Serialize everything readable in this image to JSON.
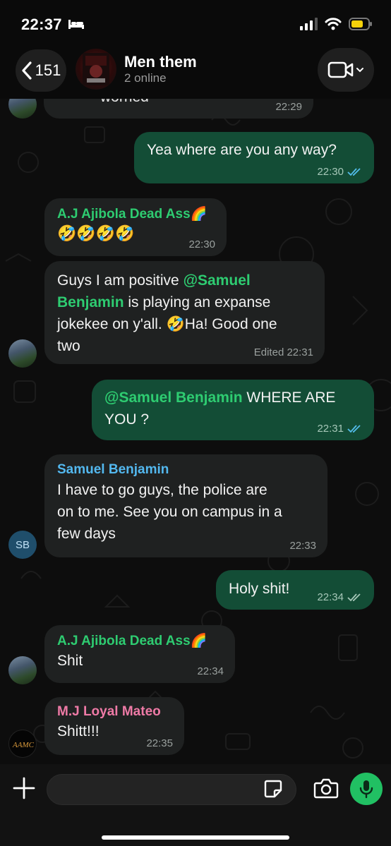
{
  "status_bar": {
    "time": "22:37"
  },
  "header": {
    "back_count": "151",
    "group_name": "Men them",
    "subtitle": "2 online"
  },
  "messages": [
    {
      "direction": "in",
      "sender": "",
      "text": "worried",
      "time": "22:29"
    },
    {
      "direction": "out",
      "text": "Yea where are you any  way?",
      "time": "22:30",
      "status": "read"
    },
    {
      "direction": "in",
      "sender": "A.J Ajibola Dead Ass🌈",
      "sender_color": "#2ecc71",
      "text": "🤣🤣🤣🤣",
      "time": "22:30"
    },
    {
      "direction": "in",
      "sender": "",
      "lines": [
        "Guys I am positive ",
        "@Samuel",
        "Benjamin",
        " is playing an expanse",
        "jokekee on y'all. 🤣Ha! Good one",
        "two"
      ],
      "time": "Edited 22:31"
    },
    {
      "direction": "out",
      "mention": "@Samuel Benjamin",
      "text": " WHERE ARE",
      "text2": "YOU ?",
      "time": "22:31",
      "status": "read"
    },
    {
      "direction": "in",
      "sender": "Samuel Benjamin",
      "sender_color": "#53b8ef",
      "lines": [
        "I have to go guys, the police are",
        "on to me. See you on campus in a",
        "few days"
      ],
      "time": "22:33",
      "avatar_initials": "SB"
    },
    {
      "direction": "out",
      "text": "Holy shit!",
      "time": "22:34",
      "status": "delivered"
    },
    {
      "direction": "in",
      "sender": "A.J Ajibola Dead Ass🌈",
      "sender_color": "#2ecc71",
      "text": "Shit",
      "time": "22:34"
    },
    {
      "direction": "in",
      "sender": "M.J Loyal Mateo",
      "sender_color": "#ee7aa6",
      "text": "Shitt!!!",
      "time": "22:35",
      "avatar_logo": "AAMC"
    }
  ],
  "composer": {
    "input_value": ""
  },
  "icons": {
    "back": "chevron-left-icon",
    "video": "video-camera-icon",
    "plus": "plus-icon",
    "sticker": "sticker-icon",
    "camera": "camera-icon",
    "mic": "microphone-icon"
  },
  "colors": {
    "outgoing_bubble": "#134d36",
    "incoming_bubble": "#1f2121",
    "accent_green": "#21c063",
    "read_tick": "#53bdeb"
  }
}
